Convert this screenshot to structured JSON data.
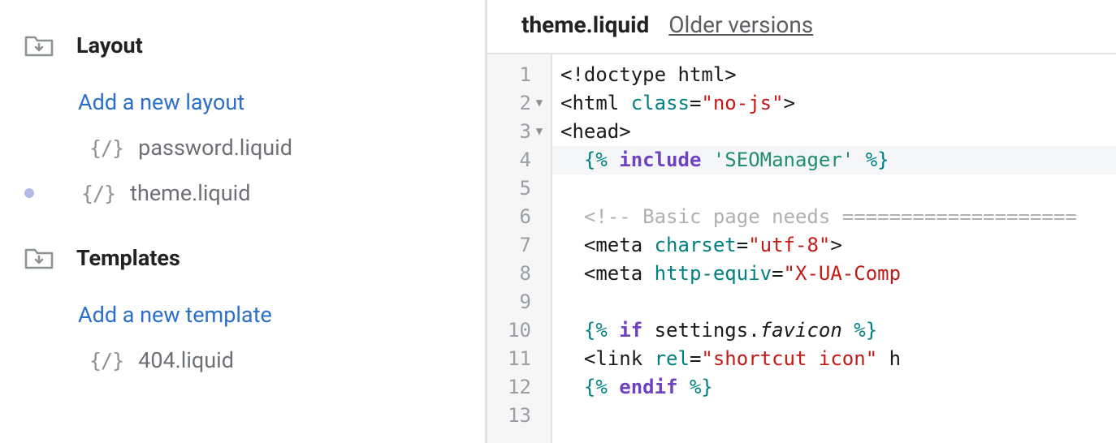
{
  "sidebar": {
    "sections": [
      {
        "title": "Layout",
        "add_label": "Add a new layout",
        "files": [
          {
            "name": "password.liquid",
            "modified": false
          },
          {
            "name": "theme.liquid",
            "modified": true
          }
        ]
      },
      {
        "title": "Templates",
        "add_label": "Add a new template",
        "files": [
          {
            "name": "404.liquid",
            "modified": false
          }
        ]
      }
    ]
  },
  "editor": {
    "title": "theme.liquid",
    "older_versions_label": "Older versions",
    "gutter": {
      "1": "1",
      "2": "2",
      "3": "3",
      "4": "4",
      "5": "5",
      "6": "6",
      "7": "7",
      "8": "8",
      "9": "9",
      "10": "10",
      "11": "11",
      "12": "12",
      "13": "13"
    },
    "code": {
      "l1": {
        "a": "<!doctype html>"
      },
      "l2": {
        "a": "<html ",
        "b": "class",
        "c": "=",
        "d": "\"no-js\"",
        "e": ">"
      },
      "l3": {
        "a": "<head>"
      },
      "l4": {
        "a": "  {% ",
        "b": "include",
        "c": " ",
        "d": "'SEOManager'",
        "e": " %}"
      },
      "l5": {
        "a": ""
      },
      "l6": {
        "a": "  <!-- Basic page needs ===================="
      },
      "l7": {
        "a": "  <meta ",
        "b": "charset",
        "c": "=",
        "d": "\"utf-8\"",
        "e": ">"
      },
      "l8": {
        "a": "  <meta ",
        "b": "http-equiv",
        "c": "=",
        "d": "\"X-UA-Comp"
      },
      "l9": {
        "a": ""
      },
      "l10": {
        "a": "  {% ",
        "b": "if",
        "c": " settings",
        "d": ".",
        "e": "favicon",
        "f": " %}"
      },
      "l11": {
        "a": "  <link ",
        "b": "rel",
        "c": "=",
        "d": "\"shortcut icon\"",
        "e": " h"
      },
      "l12": {
        "a": "  {% ",
        "b": "endif",
        "c": " %}"
      },
      "l13": {
        "a": ""
      }
    }
  }
}
